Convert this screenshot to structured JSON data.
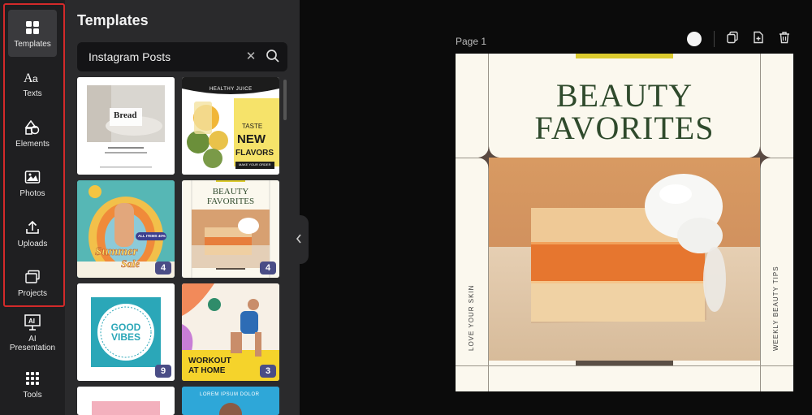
{
  "sidebar": {
    "items": [
      {
        "label": "Templates",
        "icon": "templates-icon"
      },
      {
        "label": "Texts",
        "icon": "text-icon"
      },
      {
        "label": "Elements",
        "icon": "shapes-icon"
      },
      {
        "label": "Photos",
        "icon": "image-icon"
      },
      {
        "label": "Uploads",
        "icon": "upload-icon"
      },
      {
        "label": "Projects",
        "icon": "projects-icon"
      },
      {
        "label": "AI Presentation",
        "icon": "presentation-icon"
      },
      {
        "label": "Tools",
        "icon": "grid-icon"
      }
    ],
    "active": "Templates",
    "highlight_color": "#d32a2a"
  },
  "panel": {
    "title": "Templates",
    "search": {
      "value": "Instagram Posts"
    },
    "templates": [
      {
        "name": "bread",
        "texts": [
          "Bread"
        ]
      },
      {
        "name": "healthy-juice",
        "texts": [
          "HEALTHY JUICE",
          "TASTE",
          "NEW",
          "FLAVORS",
          "MAKE YOUR ORDER"
        ]
      },
      {
        "name": "summer-sale",
        "texts": [
          "Summer",
          "Sale",
          "ALL ITEMS 40%"
        ],
        "badge": "4"
      },
      {
        "name": "beauty-favorites",
        "texts": [
          "BEAUTY",
          "FAVORITES"
        ],
        "badge": "4"
      },
      {
        "name": "good-vibes",
        "texts": [
          "GOOD",
          "VIBES"
        ],
        "badge": "9"
      },
      {
        "name": "workout-at-home",
        "texts": [
          "WORKOUT",
          "AT HOME"
        ],
        "badge": "3"
      },
      {
        "name": "pink-template",
        "texts": []
      },
      {
        "name": "lorem-ipsum",
        "texts": [
          "LOREM IPSUM DOLOR"
        ]
      }
    ]
  },
  "canvas": {
    "page_label": "Page 1",
    "title_line1": "BEAUTY",
    "title_line2": "FAVORITES",
    "left_vertical": "LOVE YOUR SKIN",
    "right_vertical": "WEEKLY BEAUTY TIPS",
    "colors": {
      "background": "#fbf8ee",
      "title": "#2f4a2c",
      "top_bar": "#dccb2e",
      "bottom_bar": "#5a4f45"
    }
  },
  "toolbar": {
    "tools": [
      "color-swatch",
      "duplicate-icon",
      "add-page-icon",
      "trash-icon"
    ]
  }
}
